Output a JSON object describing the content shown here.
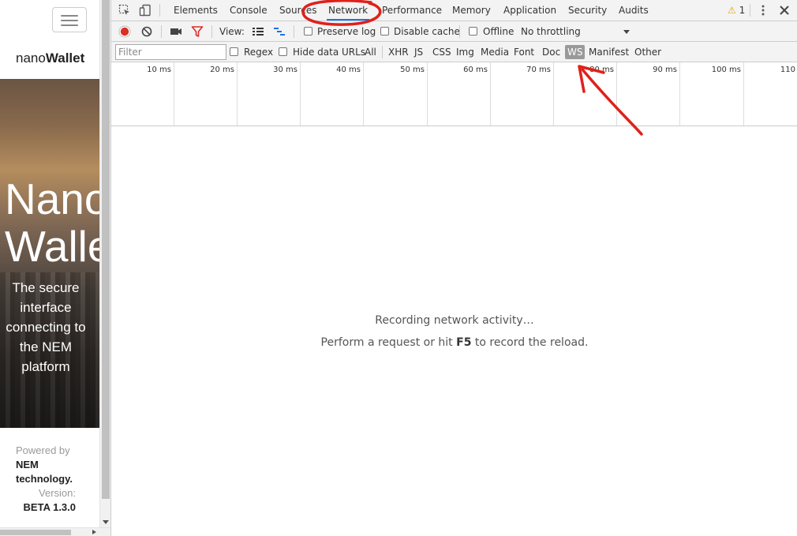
{
  "app": {
    "brand_light": "nano",
    "brand_bold": "Wallet",
    "hero_title_line1": "Nano",
    "hero_title_line2": "Wallet",
    "hero_subtitle": "The secure interface connecting to the NEM platform",
    "powered_prefix": "Powered by",
    "powered_name": "NEM technology.",
    "version_label": "Version:",
    "version_value": "BETA 1.3.0"
  },
  "devtools": {
    "tabs": [
      "Elements",
      "Console",
      "Sources",
      "Network",
      "Performance",
      "Memory",
      "Application",
      "Security",
      "Audits"
    ],
    "active_tab": "Network",
    "warning_count": "1",
    "toolbar": {
      "view_label": "View:",
      "preserve_log": "Preserve log",
      "disable_cache": "Disable cache",
      "offline": "Offline",
      "throttling": "No throttling"
    },
    "filter": {
      "placeholder": "Filter",
      "regex": "Regex",
      "hide_data_urls": "Hide data URLs",
      "types": [
        "All",
        "XHR",
        "JS",
        "CSS",
        "Img",
        "Media",
        "Font",
        "Doc",
        "WS",
        "Manifest",
        "Other"
      ],
      "selected_type": "WS"
    },
    "timeline_ticks": [
      "10 ms",
      "20 ms",
      "30 ms",
      "40 ms",
      "50 ms",
      "60 ms",
      "70 ms",
      "80 ms",
      "90 ms",
      "100 ms",
      "110"
    ],
    "empty_title": "Recording network activity…",
    "empty_hint_before": "Perform a request or hit",
    "empty_hint_key": "F5",
    "empty_hint_after": "to record the reload."
  },
  "colors": {
    "record": "#d93025",
    "accent": "#1a73e8",
    "annotation": "#e0201a",
    "warning": "#e4a700"
  }
}
